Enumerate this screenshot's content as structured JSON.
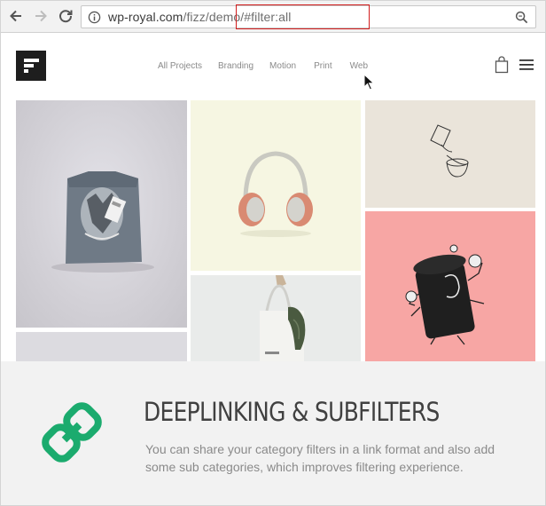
{
  "browser": {
    "url_prefix": "wp-royal.com",
    "url_path": "/fizz/demo/",
    "url_hash": "#filter:all"
  },
  "nav": {
    "items": [
      {
        "label": "All Projects"
      },
      {
        "label": "Branding"
      },
      {
        "label": "Motion"
      },
      {
        "label": "Print"
      },
      {
        "label": "Web"
      }
    ]
  },
  "feature": {
    "title": "DEEPLINKING & SUBFILTERS",
    "description": "You can share your category filters in a link format and also add some sub categories, which improves filtering experience."
  },
  "colors": {
    "accent_green": "#1bab6e",
    "highlight_red": "#d21d1d",
    "logo_dark": "#1e1e1e"
  },
  "icons": [
    "back-arrow-icon",
    "forward-arrow-icon",
    "reload-icon",
    "info-icon",
    "search-icon",
    "logo-icon",
    "cart-icon",
    "menu-icon",
    "link-chain-icon"
  ]
}
